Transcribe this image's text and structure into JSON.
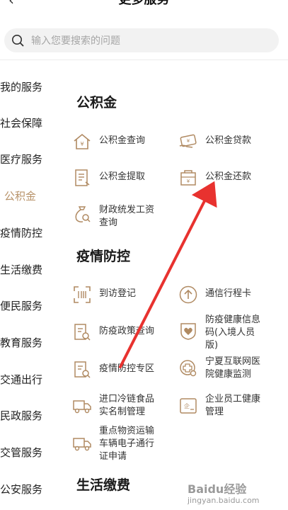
{
  "header": {
    "title": "更多服务"
  },
  "search": {
    "placeholder": "输入您要搜索的问题"
  },
  "sidebar": {
    "items": [
      {
        "label": "我的服务"
      },
      {
        "label": "社会保障"
      },
      {
        "label": "医疗服务"
      },
      {
        "label": "公积金",
        "active": true
      },
      {
        "label": "疫情防控"
      },
      {
        "label": "生活缴费"
      },
      {
        "label": "便民服务"
      },
      {
        "label": "教育服务"
      },
      {
        "label": "交通出行"
      },
      {
        "label": "民政服务"
      },
      {
        "label": "交管服务"
      },
      {
        "label": "公安服务"
      }
    ]
  },
  "sections": {
    "gjj": {
      "title": "公积金",
      "items": [
        {
          "label": "公积金查询",
          "icon": "house-yuan-icon"
        },
        {
          "label": "公积金贷款",
          "icon": "card-hand-icon"
        },
        {
          "label": "公积金提取",
          "icon": "document-icon"
        },
        {
          "label": "公积金还款",
          "icon": "safe-yuan-icon"
        },
        {
          "label": "财政统发工资查询",
          "icon": "money-bag-search-icon"
        }
      ]
    },
    "yqfk": {
      "title": "疫情防控",
      "items": [
        {
          "label": "到访登记",
          "icon": "scan-icon"
        },
        {
          "label": "通信行程卡",
          "icon": "up-arrow-circle-icon"
        },
        {
          "label": "防疫政策查询",
          "icon": "document-search-icon"
        },
        {
          "label": "防疫健康信息码(入境人员版)",
          "icon": "health-heart-icon"
        },
        {
          "label": "疫情防控专区",
          "icon": "document-search-icon"
        },
        {
          "label": "宁夏互联网医院健康监测",
          "icon": "hospital-icon"
        },
        {
          "label": "进口冷链食品实名制管理",
          "icon": "truck-icon"
        },
        {
          "label": "企业员工健康管理",
          "icon": "id-card-icon"
        },
        {
          "label": "重点物资运输车辆电子通行证申请",
          "icon": "truck-icon"
        }
      ]
    },
    "shjf": {
      "title": "生活缴费"
    }
  },
  "watermark": {
    "brand": "Baidu经验",
    "domain": "jingyan.baidu.com"
  },
  "colors": {
    "accent": "#b8936a",
    "icon": "#b08a62",
    "arrow": "#e8322f"
  }
}
